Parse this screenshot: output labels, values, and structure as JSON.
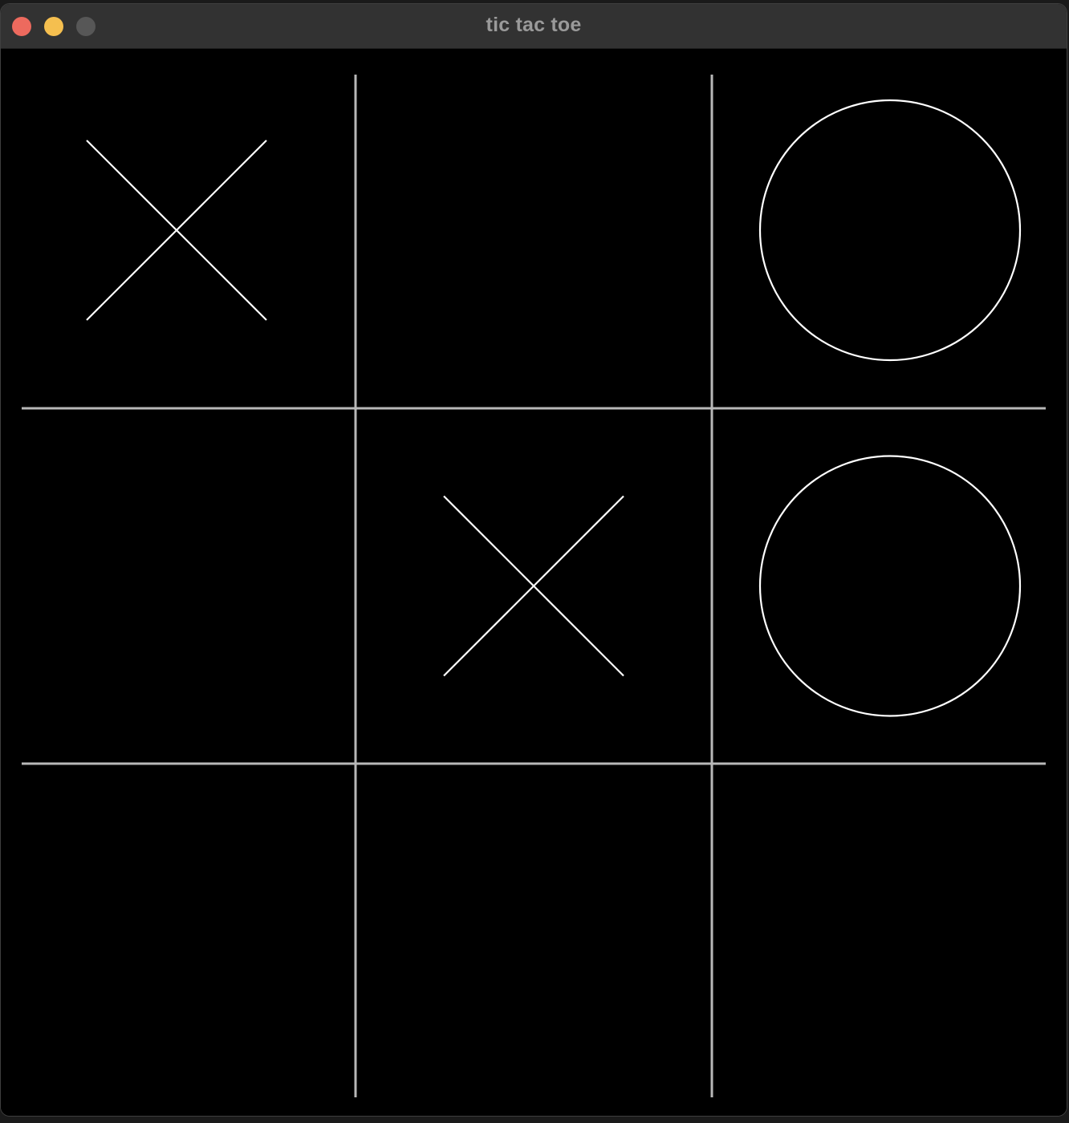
{
  "window": {
    "title": "tic tac toe",
    "controls": [
      {
        "name": "close-button",
        "color": "#ed6a5e"
      },
      {
        "name": "minimize-button",
        "color": "#f5bf4f"
      },
      {
        "name": "zoom-button",
        "color": "#575757"
      }
    ]
  },
  "theme": {
    "background": "#000000",
    "grid_color": "#b8b8b8",
    "mark_color": "#ffffff"
  },
  "board": {
    "size": 3,
    "cells": [
      [
        "X",
        "",
        "O"
      ],
      [
        "",
        "X",
        "O"
      ],
      [
        "",
        "",
        ""
      ]
    ]
  }
}
